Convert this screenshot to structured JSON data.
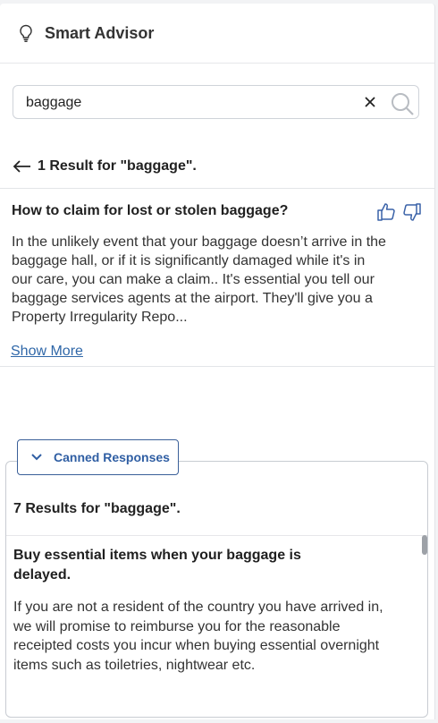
{
  "header": {
    "title": "Smart Advisor",
    "icon": "lightbulb-icon"
  },
  "search": {
    "value": "baggage",
    "placeholder": ""
  },
  "results": {
    "summary": "1 Result for \"baggage\"."
  },
  "article": {
    "title": "How to claim for lost or stolen baggage?",
    "body": "In the unlikely event that your baggage doesn’t arrive in the baggage hall, or if it is significantly damaged while it's in our care, you can make a claim.. It's essential you tell our baggage services agents at the airport.  They'll give you a Property Irregularity Repo...",
    "show_more": "Show More"
  },
  "canned": {
    "button_label": "Canned Responses",
    "summary": "7 Results for \"baggage\".",
    "item_title": "Buy essential items when your baggage is delayed.",
    "item_body": "If you are not a resident of the country you have arrived in, we will promise to reimburse you for the reasonable receipted costs you incur when buying essential overnight items such as toiletries, nightwear etc."
  },
  "colors": {
    "accent": "#2f5ea3",
    "link": "#2f67a8",
    "border": "#c8ccd2"
  }
}
